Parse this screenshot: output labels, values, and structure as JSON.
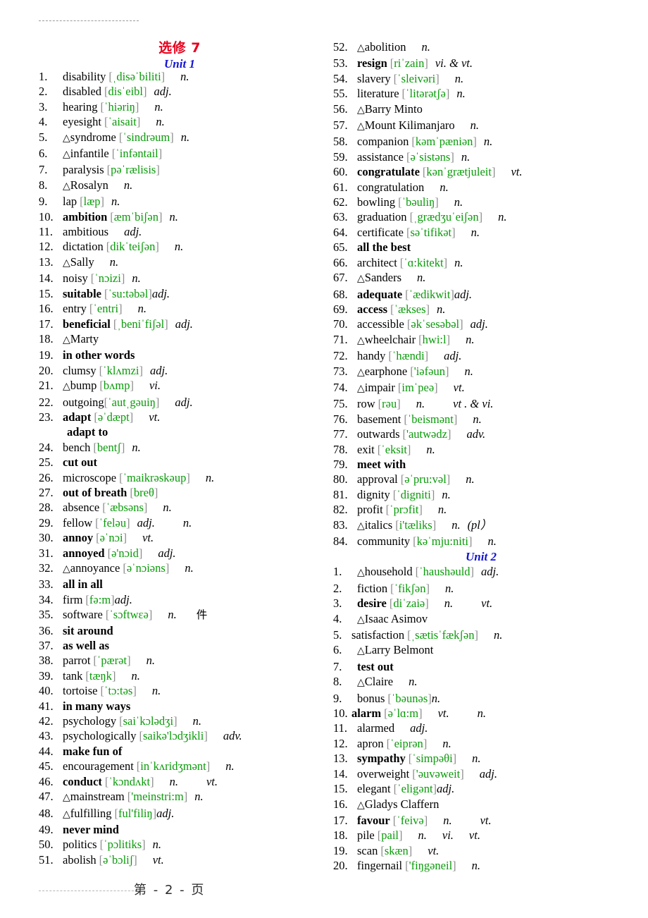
{
  "document": {
    "title_main": "选修 7",
    "footer_text": "第 - 2 - 页"
  },
  "units": [
    {
      "id": "unit1",
      "label": "Unit 1"
    },
    {
      "id": "unit2",
      "label": "Unit 2"
    }
  ],
  "left_column": [
    {
      "num": "1.",
      "tri": "",
      "word": "disability",
      "bold": false,
      "ph": "[ˌdisəˈbiliti]",
      "pos": [
        "n."
      ],
      "gap": "m"
    },
    {
      "num": "2.",
      "tri": "",
      "word": "disabled",
      "bold": false,
      "ph": "[disˈeibl]",
      "pos": [
        "adj."
      ],
      "gap": "s"
    },
    {
      "num": "3.",
      "tri": "",
      "word": "hearing",
      "bold": false,
      "ph": "[ˈhiəriŋ]",
      "pos": [
        "n."
      ],
      "gap": "m"
    },
    {
      "num": "4.",
      "tri": "",
      "word": " eyesight",
      "bold": false,
      "ph": "[ˈaisait]",
      "pos": [
        "n."
      ],
      "gap": "m"
    },
    {
      "num": "5.",
      "tri": "△",
      "word": "syndrome",
      "bold": false,
      "ph": "[ˈsindrəum]",
      "pos": [
        "n."
      ],
      "gap": "s"
    },
    {
      "num": "6.",
      "tri": "△",
      "word": "infantile",
      "bold": false,
      "ph": "[ˈinfəntail]",
      "pos": [],
      "gap": "s"
    },
    {
      "num": "7.",
      "tri": "",
      "word": "paralysis",
      "bold": false,
      "ph": "[pəˈrælisis]",
      "pos": [],
      "gap": "s"
    },
    {
      "num": "8.",
      "tri": "△",
      "word": "Rosalyn",
      "bold": false,
      "ph": "",
      "pos": [
        "n."
      ],
      "gap": "m"
    },
    {
      "num": "9.",
      "tri": "",
      "word": "lap",
      "bold": false,
      "ph": "[læp]",
      "pos": [
        "n."
      ],
      "gap": "s"
    },
    {
      "num": "10.",
      "tri": "",
      "word": "ambition",
      "bold": true,
      "ph": "[æmˈbiʃən]",
      "pos": [
        "n."
      ],
      "gap": "s"
    },
    {
      "num": "11.",
      "tri": "",
      "word": "ambitious",
      "bold": false,
      "ph": "",
      "pos": [
        "adj."
      ],
      "gap": "m"
    },
    {
      "num": "12.",
      "tri": "",
      "word": "dictation",
      "bold": false,
      "ph": "[dikˈteiʃən]",
      "pos": [
        "n."
      ],
      "gap": "m"
    },
    {
      "num": "13.",
      "tri": "△",
      "word": "Sally",
      "bold": false,
      "ph": "",
      "pos": [
        "n."
      ],
      "gap": "m"
    },
    {
      "num": "14.",
      "tri": "",
      "word": "noisy",
      "bold": false,
      "ph": "[ˈnɔizi]",
      "pos": [
        "n."
      ],
      "gap": "s"
    },
    {
      "num": "15.",
      "tri": "",
      "word": "suitable",
      "bold": true,
      "ph": "[ˈsu:təbəl]",
      "pos": [
        "adj."
      ],
      "gap": "none"
    },
    {
      "num": "16.",
      "tri": "",
      "word": "entry",
      "bold": false,
      "ph": "[ˈentri]",
      "pos": [
        "n."
      ],
      "gap": "m"
    },
    {
      "num": "17.",
      "tri": "",
      "word": "beneficial",
      "bold": true,
      "ph": "[ˌbeniˈfiʃəl]",
      "pos": [
        "adj."
      ],
      "gap": "s"
    },
    {
      "num": "18.",
      "tri": "△",
      "word": "Marty",
      "bold": false,
      "ph": "",
      "pos": [],
      "gap": "s"
    },
    {
      "num": "19.",
      "tri": "",
      "word": "in other words",
      "bold": true,
      "ph": "",
      "pos": [],
      "gap": "s"
    },
    {
      "num": "20.",
      "tri": "",
      "word": "clumsy",
      "bold": false,
      "ph": "[ˈklʌmzi]",
      "pos": [
        "adj."
      ],
      "gap": "s"
    },
    {
      "num": "21.",
      "tri": "△",
      "word": "bump",
      "bold": false,
      "ph": "[bʌmp]",
      "pos": [
        "vi."
      ],
      "gap": "m"
    },
    {
      "num": "22.",
      "tri": "",
      "word": "outgoing",
      "bold": false,
      "ph": "[ˈautˌgəuiŋ]",
      "pos": [
        "adj."
      ],
      "gap": "m",
      "tight": true
    },
    {
      "num": "23.",
      "tri": "",
      "word": "adapt",
      "bold": true,
      "ph": "[əˈdæpt]",
      "pos": [
        "vt."
      ],
      "gap": "m",
      "subline": "adapt to"
    },
    {
      "num": "24.",
      "tri": "",
      "word": "bench",
      "bold": false,
      "ph": "[bentʃ]",
      "pos": [
        "n."
      ],
      "gap": "s"
    },
    {
      "num": "25.",
      "tri": "",
      "word": "cut out",
      "bold": true,
      "ph": "",
      "pos": [],
      "gap": "s"
    },
    {
      "num": "26.",
      "tri": "",
      "word": "microscope",
      "bold": false,
      "ph": "[ˈmaikrəskəup]",
      "pos": [
        "n."
      ],
      "gap": "m"
    },
    {
      "num": "27.",
      "tri": "",
      "word": "out of breath",
      "bold": true,
      "ph": "[breθ]",
      "pos": [],
      "gap": "s"
    },
    {
      "num": "28.",
      "tri": "",
      "word": "absence",
      "bold": false,
      "ph": "[ˈæbsəns]",
      "pos": [
        "n."
      ],
      "gap": "m"
    },
    {
      "num": "29.",
      "tri": "",
      "word": "fellow",
      "bold": false,
      "ph": "[ˈfeləu]",
      "pos": [
        "adj.",
        "n."
      ],
      "gap": "s",
      "posgap": "l"
    },
    {
      "num": "30.",
      "tri": "",
      "word": "annoy",
      "bold": true,
      "ph": "[əˈnɔi]",
      "pos": [
        "vt."
      ],
      "gap": "m"
    },
    {
      "num": "31.",
      "tri": "",
      "word": "annoyed",
      "bold": true,
      "ph": "[ə'nɔid]",
      "pos": [
        "adj."
      ],
      "gap": "m"
    },
    {
      "num": "32.",
      "tri": "△",
      "word": "annoyance",
      "bold": false,
      "ph": "[əˈnɔiəns]",
      "pos": [
        "n."
      ],
      "gap": "m"
    },
    {
      "num": "33.",
      "tri": "",
      "word": "all in all",
      "bold": true,
      "ph": "",
      "pos": [],
      "gap": "s"
    },
    {
      "num": "34.",
      "tri": "",
      "word": "firm",
      "bold": false,
      "ph": "[fə:m]",
      "pos": [
        "adj."
      ],
      "gap": "none"
    },
    {
      "num": "35.",
      "tri": "",
      "word": "software",
      "bold": false,
      "ph": "[ˈsɔftwɛə]",
      "pos": [
        "n."
      ],
      "gap": "m",
      "cn": "件"
    },
    {
      "num": "36.",
      "tri": "",
      "word": "sit around",
      "bold": true,
      "ph": "",
      "pos": [],
      "gap": "s"
    },
    {
      "num": "37.",
      "tri": "",
      "word": "as well as",
      "bold": true,
      "ph": "",
      "pos": [],
      "gap": "s"
    },
    {
      "num": "38.",
      "tri": "",
      "word": "parrot",
      "bold": false,
      "ph": "[ˈpærət]",
      "pos": [
        "n."
      ],
      "gap": "m"
    },
    {
      "num": "39.",
      "tri": "",
      "word": "tank",
      "bold": false,
      "ph": "[tæŋk]",
      "pos": [
        "n."
      ],
      "gap": "m"
    },
    {
      "num": "40.",
      "tri": "",
      "word": "tortoise",
      "bold": false,
      "ph": "[ˈtɔ:təs]",
      "pos": [
        "n."
      ],
      "gap": "m"
    },
    {
      "num": "41.",
      "tri": "",
      "word": "in many ways",
      "bold": true,
      "ph": "",
      "pos": [],
      "gap": "s"
    },
    {
      "num": "42.",
      "tri": "",
      "word": "psychology",
      "bold": false,
      "ph": "[saiˈkɔlədʒi]",
      "pos": [
        "n."
      ],
      "gap": "m"
    },
    {
      "num": "43.",
      "tri": "",
      "word": "psychologically",
      "bold": false,
      "ph": "[saikə'lɔdʒikli]",
      "pos": [
        "adv."
      ],
      "gap": "m"
    },
    {
      "num": "44.",
      "tri": "",
      "word": "make fun of",
      "bold": true,
      "ph": "",
      "pos": [],
      "gap": "s"
    },
    {
      "num": "45.",
      "tri": "",
      "word": "encouragement",
      "bold": false,
      "ph": "[inˈkʌridʒmənt]",
      "pos": [
        "n."
      ],
      "gap": "m"
    },
    {
      "num": "46.",
      "tri": "",
      "word": "conduct",
      "bold": true,
      "ph": "[ˈkɔndʌkt]",
      "pos": [
        "n.",
        "vt."
      ],
      "gap": "m",
      "posgap": "l"
    },
    {
      "num": "47.",
      "tri": "△",
      "word": "mainstream",
      "bold": false,
      "ph": "['meinstri:m]",
      "pos": [
        "n."
      ],
      "gap": "s"
    },
    {
      "num": "48.",
      "tri": "△",
      "word": "fulfilling",
      "bold": false,
      "ph": "[ful'filiŋ]",
      "pos": [
        "adj."
      ],
      "gap": "none"
    },
    {
      "num": "49.",
      "tri": "",
      "word": "never mind",
      "bold": true,
      "ph": "",
      "pos": [],
      "gap": "s"
    },
    {
      "num": "50.",
      "tri": "",
      "word": "politics",
      "bold": false,
      "ph": "[ˈpɔlitiks]",
      "pos": [
        "n."
      ],
      "gap": "s"
    },
    {
      "num": "51.",
      "tri": "",
      "word": "abolish",
      "bold": false,
      "ph": "[əˈbɔliʃ]",
      "pos": [
        "vt."
      ],
      "gap": "m"
    }
  ],
  "right_column_unit1": [
    {
      "num": "52.",
      "tri": "△",
      "word": "abolition",
      "bold": false,
      "ph": "",
      "pos": [
        "n."
      ],
      "gap": "m"
    },
    {
      "num": "53.",
      "tri": "",
      "word": "resign",
      "bold": true,
      "ph": "[riˈzain]",
      "pos": [
        "vi. & vt."
      ],
      "gap": "s"
    },
    {
      "num": "54.",
      "tri": "",
      "word": "slavery",
      "bold": false,
      "ph": "[ˈsleivəri]",
      "pos": [
        "n."
      ],
      "gap": "m"
    },
    {
      "num": "55.",
      "tri": "",
      "word": "literature",
      "bold": false,
      "ph": "[ˈlitərətʃə]",
      "pos": [
        "n."
      ],
      "gap": "s"
    },
    {
      "num": "56.",
      "tri": "△",
      "word": "Barry Minto",
      "bold": false,
      "ph": "",
      "pos": [],
      "gap": "s"
    },
    {
      "num": "57.",
      "tri": "△",
      "word": "Mount Kilimanjaro",
      "bold": false,
      "ph": "",
      "pos": [
        "n."
      ],
      "gap": "m"
    },
    {
      "num": "58.",
      "tri": "",
      "word": "companion",
      "bold": false,
      "ph": "[kəmˈpæniən]",
      "pos": [
        "n."
      ],
      "gap": "s"
    },
    {
      "num": "59.",
      "tri": "",
      "word": "assistance",
      "bold": false,
      "ph": "[əˈsistəns]",
      "pos": [
        "n."
      ],
      "gap": "s"
    },
    {
      "num": "60.",
      "tri": "",
      "word": "congratulate",
      "bold": true,
      "ph": "[kənˈgrætjuleit]",
      "pos": [
        "vt."
      ],
      "gap": "m"
    },
    {
      "num": "61.",
      "tri": "",
      "word": "congratulation",
      "bold": false,
      "ph": "",
      "pos": [
        "n."
      ],
      "gap": "m"
    },
    {
      "num": "62.",
      "tri": "",
      "word": "bowling",
      "bold": false,
      "ph": "[ˈbəuliŋ]",
      "pos": [
        "n."
      ],
      "gap": "m"
    },
    {
      "num": "63.",
      "tri": "",
      "word": "graduation",
      "bold": false,
      "ph": "[ˌgrædʒuˈeiʃən]",
      "pos": [
        "n."
      ],
      "gap": "m"
    },
    {
      "num": "64.",
      "tri": "",
      "word": "certificate",
      "bold": false,
      "ph": "[səˈtifikət]",
      "pos": [
        "n."
      ],
      "gap": "m"
    },
    {
      "num": "65.",
      "tri": "",
      "word": "all the best",
      "bold": true,
      "ph": "",
      "pos": [],
      "gap": "s"
    },
    {
      "num": "66.",
      "tri": "",
      "word": "architect",
      "bold": false,
      "ph": "[ˈɑ:kitekt]",
      "pos": [
        "n."
      ],
      "gap": "s"
    },
    {
      "num": "67.",
      "tri": "△",
      "word": "Sanders",
      "bold": false,
      "ph": "",
      "pos": [
        "n."
      ],
      "gap": "m"
    },
    {
      "num": "68.",
      "tri": "",
      "word": "adequate",
      "bold": true,
      "ph": "[ˈædikwit]",
      "pos": [
        "adj."
      ],
      "gap": "none"
    },
    {
      "num": "69.",
      "tri": "",
      "word": "access",
      "bold": true,
      "ph": "[ˈækses]",
      "pos": [
        "n."
      ],
      "gap": "s"
    },
    {
      "num": "70.",
      "tri": "",
      "word": "accessible",
      "bold": false,
      "ph": "[əkˈsesəbəl]",
      "pos": [
        "adj."
      ],
      "gap": "s"
    },
    {
      "num": "71.",
      "tri": "△",
      "word": "wheelchair",
      "bold": false,
      "ph": "[hwi:l]",
      "pos": [
        "n."
      ],
      "gap": "m"
    },
    {
      "num": "72.",
      "tri": "",
      "word": "handy",
      "bold": false,
      "ph": "[ˈhændi]",
      "pos": [
        "adj."
      ],
      "gap": "m"
    },
    {
      "num": "73.",
      "tri": "△",
      "word": "earphone",
      "bold": false,
      "ph": "['iəfəun]",
      "pos": [
        "n."
      ],
      "gap": "m"
    },
    {
      "num": "74.",
      "tri": "△",
      "word": "impair",
      "bold": false,
      "ph": "[imˈpeə]",
      "pos": [
        "vt."
      ],
      "gap": "m"
    },
    {
      "num": "75.",
      "tri": "",
      "word": "row",
      "bold": false,
      "ph": "[rəu]",
      "pos": [
        "n.",
        "vt . & vi."
      ],
      "gap": "m",
      "posgap": "l"
    },
    {
      "num": "76.",
      "tri": "",
      "word": "basement",
      "bold": false,
      "ph": "[ˈbeismənt]",
      "pos": [
        "n."
      ],
      "gap": "m"
    },
    {
      "num": "77.",
      "tri": "",
      "word": "outwards",
      "bold": false,
      "ph": "['autwədz]",
      "pos": [
        "adv."
      ],
      "gap": "m"
    },
    {
      "num": "78.",
      "tri": "",
      "word": "exit",
      "bold": false,
      "ph": "[ˈeksit]",
      "pos": [
        "n."
      ],
      "gap": "m"
    },
    {
      "num": "79.",
      "tri": "",
      "word": "meet with",
      "bold": true,
      "ph": "",
      "pos": [],
      "gap": "s"
    },
    {
      "num": "80.",
      "tri": "",
      "word": "approval",
      "bold": false,
      "ph": "[əˈpru:vəl]",
      "pos": [
        "n."
      ],
      "gap": "m"
    },
    {
      "num": "81.",
      "tri": "",
      "word": "dignity",
      "bold": false,
      "ph": "[ˈdigniti]",
      "pos": [
        "n."
      ],
      "gap": "s"
    },
    {
      "num": "82.",
      "tri": "",
      "word": "profit",
      "bold": false,
      "ph": "[ˈprɔfit]",
      "pos": [
        "n."
      ],
      "gap": "m"
    },
    {
      "num": "83.",
      "tri": "△",
      "word": "italics",
      "bold": false,
      "ph": "[i'tæliks]",
      "pos": [
        "n.",
        "(pl）"
      ],
      "gap": "m",
      "posgap": "s",
      "pos_last_italic": true
    },
    {
      "num": "84.",
      "tri": "",
      "word": "community",
      "bold": false,
      "ph": "[kəˈmju:niti]",
      "pos": [
        "n."
      ],
      "gap": "m"
    }
  ],
  "right_column_unit2": [
    {
      "num": "1.",
      "tri": "△",
      "word": "household",
      "bold": false,
      "ph": "[ˈhaushəuld]",
      "pos": [
        "adj."
      ],
      "gap": "s"
    },
    {
      "num": "2.",
      "tri": "",
      "word": "fiction",
      "bold": false,
      "ph": "[ˈfikʃən]",
      "pos": [
        "n."
      ],
      "gap": "m"
    },
    {
      "num": "3.",
      "tri": "",
      "word": "desire",
      "bold": true,
      "ph": "[diˈzaiə]",
      "pos": [
        "n.",
        "vt."
      ],
      "gap": "m",
      "posgap": "l"
    },
    {
      "num": "4.",
      "tri": "△",
      "word": "Isaac Asimov",
      "bold": false,
      "ph": "",
      "pos": [],
      "gap": "s"
    },
    {
      "num": "5.",
      "tri": "",
      "word": "satisfaction",
      "bold": false,
      "ph": "[ˌsætisˈfækʃən]",
      "pos": [
        "n."
      ],
      "gap": "m",
      "numnarrow": true
    },
    {
      "num": "6.",
      "tri": "△",
      "word": "Larry Belmont",
      "bold": false,
      "ph": "",
      "pos": [],
      "gap": "s"
    },
    {
      "num": "7.",
      "tri": "",
      "word": "test out",
      "bold": true,
      "ph": "",
      "pos": [],
      "gap": "s"
    },
    {
      "num": "8.",
      "tri": "△",
      "word": "Claire",
      "bold": false,
      "ph": "",
      "pos": [
        "n."
      ],
      "gap": "m"
    },
    {
      "num": "9.",
      "tri": "",
      "word": "bonus",
      "bold": false,
      "ph": "[ˈbəunəs]",
      "pos": [
        "n."
      ],
      "gap": "none"
    },
    {
      "num": "10.",
      "tri": "",
      "word": "alarm",
      "bold": true,
      "ph": "[əˈlɑ:m]",
      "pos": [
        "vt.",
        "n."
      ],
      "gap": "m",
      "posgap": "l",
      "numnarrow": true
    },
    {
      "num": "11.",
      "tri": "",
      "word": "alarmed",
      "bold": false,
      "ph": "",
      "pos": [
        "adj."
      ],
      "gap": "m"
    },
    {
      "num": "12.",
      "tri": "",
      "word": "apron",
      "bold": false,
      "ph": "[ˈeiprən]",
      "pos": [
        "n."
      ],
      "gap": "m"
    },
    {
      "num": "13.",
      "tri": "",
      "word": "sympathy",
      "bold": true,
      "ph": "[ˈsimpəθi]",
      "pos": [
        "n."
      ],
      "gap": "m"
    },
    {
      "num": "14.",
      "tri": "",
      "word": "overweight",
      "bold": false,
      "ph": "['əuvəweit]",
      "pos": [
        "adj."
      ],
      "gap": "m"
    },
    {
      "num": "15.",
      "tri": "",
      "word": "elegant",
      "bold": false,
      "ph": "[ˈeligənt]",
      "pos": [
        "adj."
      ],
      "gap": "none"
    },
    {
      "num": "16.",
      "tri": "△",
      "word": "Gladys Claffern",
      "bold": false,
      "ph": "",
      "pos": [],
      "gap": "s"
    },
    {
      "num": "17.",
      "tri": "",
      "word": "favour",
      "bold": true,
      "ph": "[ˈfeivə]",
      "pos": [
        "n.",
        "vt."
      ],
      "gap": "m",
      "posgap": "l"
    },
    {
      "num": "18.",
      "tri": "",
      "word": "pile",
      "bold": false,
      "ph": "[pail]",
      "pos": [
        "n.",
        "vi.",
        "vt."
      ],
      "gap": "m",
      "posgap": "m"
    },
    {
      "num": "19.",
      "tri": "",
      "word": "scan",
      "bold": false,
      "ph": "[skæn]",
      "pos": [
        "vt."
      ],
      "gap": "m"
    },
    {
      "num": "20.",
      "tri": "",
      "word": "fingernail",
      "bold": false,
      "ph": "['fiŋgəneil]",
      "pos": [
        "n."
      ],
      "gap": "m"
    }
  ]
}
